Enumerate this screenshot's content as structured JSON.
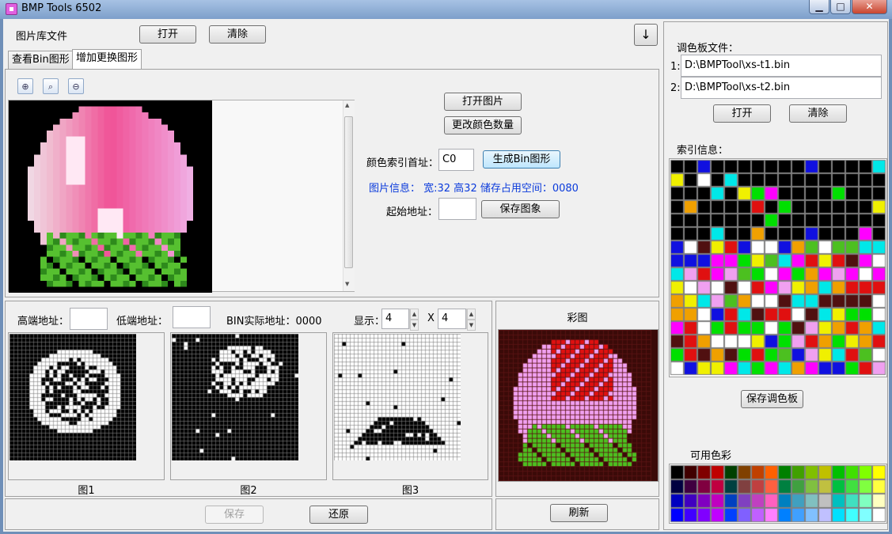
{
  "window": {
    "title": "BMP Tools 6502",
    "min": "▁",
    "max": "□",
    "close": "✕"
  },
  "library": {
    "label": "图片库文件",
    "open": "打开",
    "clear": "清除",
    "down": "↓"
  },
  "tabs": [
    "查看Bin图形",
    "增加更换图形"
  ],
  "tools": [
    "zoom-in-icon",
    "zoom-icon",
    "zoom-out-icon"
  ],
  "image_panel": {
    "open_image": "打开图片",
    "change_colors": "更改颜色数量",
    "color_index_label": "颜色索引首址：",
    "color_index_value": "C0",
    "generate_bin": "生成Bin图形",
    "info": "图片信息： 宽:32  高32  储存占用空间：0080",
    "start_addr_label": "起始地址：",
    "start_addr_value": "",
    "save_image": "保存图象"
  },
  "bin_panel": {
    "high_addr_label": "高端地址：",
    "high_addr_value": "",
    "low_addr_label": "低端地址：",
    "low_addr_value": "",
    "bin_addr": "BIN实际地址：0000",
    "display_label": "显示：",
    "display_w": "4",
    "x": "X",
    "display_h": "4",
    "captions": [
      "图1",
      "图2",
      "图3"
    ],
    "save": "保存",
    "restore": "还原"
  },
  "color_panel": {
    "title": "彩图",
    "refresh": "刷新"
  },
  "palette_panel": {
    "label": "调色板文件：",
    "files": [
      {
        "n": "1:",
        "path": "D:\\BMPTool\\xs-t1.bin"
      },
      {
        "n": "2:",
        "path": "D:\\BMPTool\\xs-t2.bin"
      }
    ],
    "open": "打开",
    "clear": "清除",
    "index_label": "索引信息：",
    "save_palette": "保存调色板",
    "available_label": "可用色彩"
  },
  "colors": {
    "accent": "#0a3adb",
    "black": "#000000",
    "white": "#ffffff",
    "green": "#00e000",
    "yellow": "#f0f000",
    "orange": "#f0a000",
    "magenta": "#ff00ff",
    "pink": "#f0a0f0",
    "red": "#e01010",
    "blue": "#1010e0",
    "cyan": "#00e8e8",
    "lime": "#4cc020",
    "dark_red": "#501010",
    "maroon": "#3a0a08"
  }
}
